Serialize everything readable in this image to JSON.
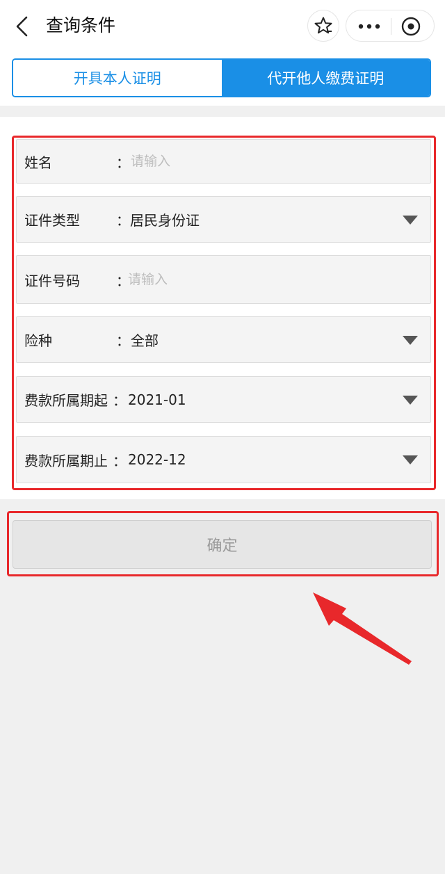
{
  "nav": {
    "title": "查询条件",
    "icons": [
      "back-icon",
      "star-icon",
      "more-icon",
      "close-target-icon"
    ]
  },
  "tabs": [
    {
      "label": "开具本人证明",
      "active": false
    },
    {
      "label": "代开他人缴费证明",
      "active": true
    }
  ],
  "form": {
    "colon": "：",
    "name": {
      "label": "姓名",
      "placeholder": "请输入",
      "value": ""
    },
    "id_type": {
      "label": "证件类型",
      "value": "居民身份证"
    },
    "id_number": {
      "label": "证件号码",
      "placeholder": "请输入",
      "value": ""
    },
    "insurance": {
      "label": "险种",
      "value": "全部"
    },
    "period_start": {
      "label": "费款所属期起",
      "value": "2021-01"
    },
    "period_end": {
      "label": "费款所属期止",
      "value": "2022-12"
    }
  },
  "confirm": {
    "label": "确定"
  },
  "colors": {
    "accent": "#1a8fe6",
    "annotation": "#e8282b",
    "disabled_text": "#9a9a9a"
  }
}
